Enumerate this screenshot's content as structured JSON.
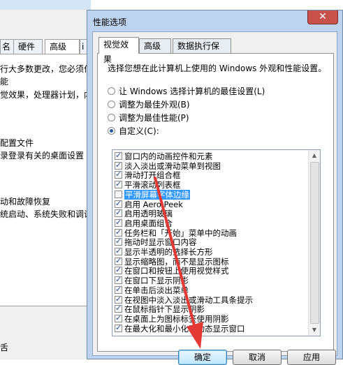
{
  "background_window": {
    "tabs": [
      "名",
      "硬件",
      "高级",
      "i"
    ],
    "active_tab": "高级",
    "lines": [
      {
        "text": "行大多数更改，您必须作"
      },
      {
        "text": "能"
      },
      {
        "text": "觉效果，处理器计划，内"
      },
      {
        "text": "配置文件"
      },
      {
        "text": "录登录有关的桌面设置"
      },
      {
        "text": "动和故障恢复"
      },
      {
        "text": "统启动、系统失败和调试"
      },
      {
        "text": "舌"
      }
    ]
  },
  "dialog": {
    "title": "性能选项",
    "close_symbol": "✕",
    "tabs": [
      {
        "label": "视觉效果",
        "active": true
      },
      {
        "label": "高级",
        "active": false
      },
      {
        "label": "数据执行保护",
        "active": false
      }
    ],
    "description": "选择您想在此计算机上使用的 Windows 外观和性能设置。",
    "radio_options": [
      {
        "label": "让 Windows 选择计算机的最佳设置(L)",
        "selected": false
      },
      {
        "label": "调整为最佳外观(B)",
        "selected": false
      },
      {
        "label": "调整为最佳性能(P)",
        "selected": false
      },
      {
        "label": "自定义(C):",
        "selected": true
      }
    ],
    "effects": [
      {
        "label": "窗口内的动画控件和元素",
        "checked": true
      },
      {
        "label": "淡入淡出或滑动菜单到视图",
        "checked": true
      },
      {
        "label": "滑动打开组合框",
        "checked": true
      },
      {
        "label": "平滑滚动列表框",
        "checked": true
      },
      {
        "label": "平滑屏幕字体边缘",
        "checked": false,
        "selected": true
      },
      {
        "label": "启用 Aero Peek",
        "checked": true
      },
      {
        "label": "启用透明玻璃",
        "checked": true
      },
      {
        "label": "启用桌面组合",
        "checked": true
      },
      {
        "label": "任务栏和「开始」菜单中的动画",
        "checked": true
      },
      {
        "label": "拖动时显示窗口内容",
        "checked": true
      },
      {
        "label": "显示半透明的选择长方形",
        "checked": true
      },
      {
        "label": "显示缩略图，而不是显示图标",
        "checked": true
      },
      {
        "label": "在窗口和按钮上使用视觉样式",
        "checked": true
      },
      {
        "label": "在窗口下显示阴影",
        "checked": true
      },
      {
        "label": "在单击后淡出菜单",
        "checked": true
      },
      {
        "label": "在视图中淡入淡出或滑动工具条提示",
        "checked": true
      },
      {
        "label": "在鼠标指针下显示阴影",
        "checked": true
      },
      {
        "label": "在桌面上为图标标签使用阴影",
        "checked": true
      },
      {
        "label": "在最大化和最小化时动态显示窗口",
        "checked": true
      }
    ],
    "buttons": {
      "ok": "确定",
      "cancel": "取消",
      "apply": "应用"
    },
    "scroll_arrows": {
      "up": "▲",
      "down": "▼"
    }
  },
  "colors": {
    "selection": "#3399ff",
    "annotation_arrow": "#e53935",
    "dialog_frame": "#bdd3ee"
  }
}
